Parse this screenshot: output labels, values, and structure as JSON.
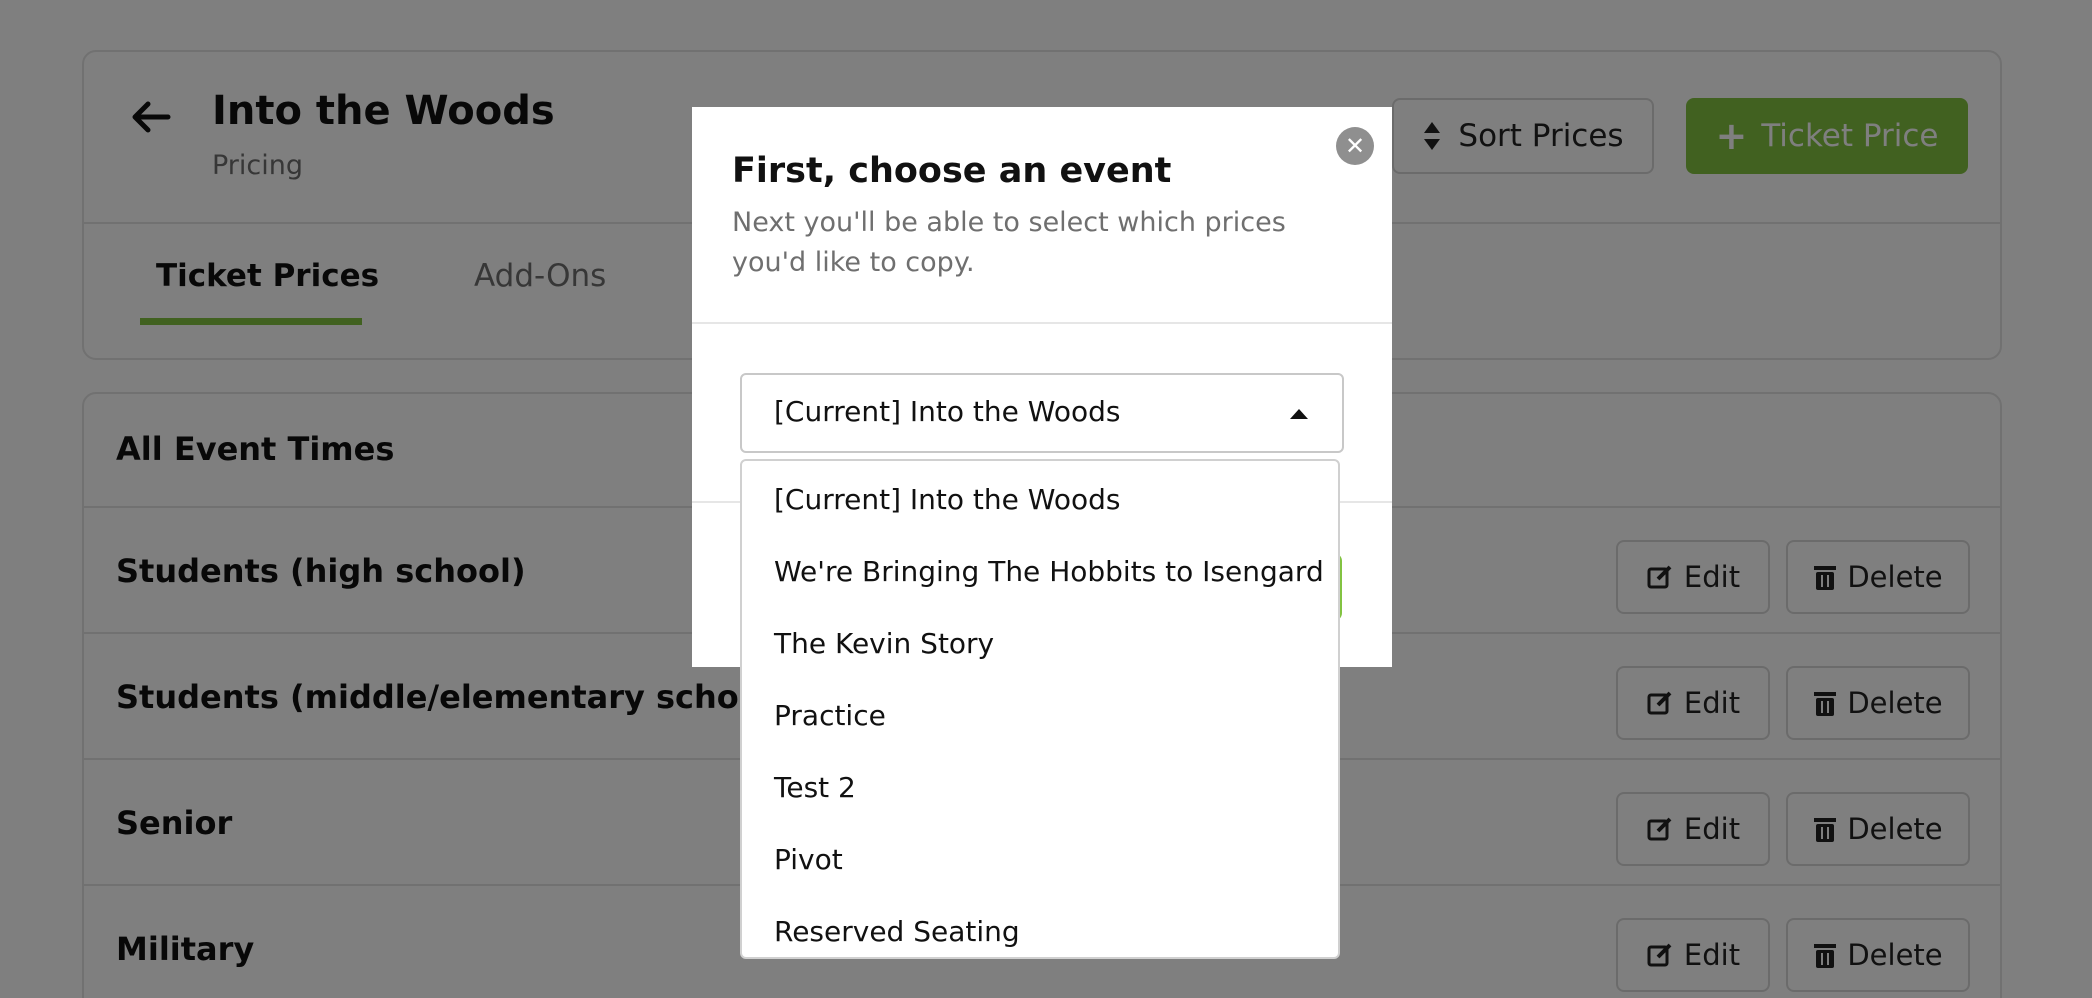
{
  "header": {
    "title": "Into the Woods",
    "subtitle": "Pricing",
    "sort_label": "Sort Prices",
    "add_ticket_label": "Ticket Price",
    "tabs": [
      {
        "label": "Ticket Prices",
        "active": true
      },
      {
        "label": "Add-Ons",
        "active": false
      }
    ]
  },
  "list": {
    "section_title": "All Event Times",
    "rows": [
      {
        "label": "Students (high school)"
      },
      {
        "label": "Students (middle/elementary school)"
      },
      {
        "label": "Senior"
      },
      {
        "label": "Military"
      }
    ],
    "edit_label": "Edit",
    "delete_label": "Delete"
  },
  "modal": {
    "title": "First, choose an event",
    "description": "Next you'll be able to select which prices you'd like to copy.",
    "close_glyph": "✕",
    "select": {
      "value": "[Current] Into the Woods",
      "options": [
        "[Current] Into the Woods",
        "We're Bringing The Hobbits to Isengard",
        "The Kevin Story",
        "Practice",
        "Test 2",
        "Pivot",
        "Reserved Seating"
      ]
    }
  },
  "colors": {
    "accent": "#82c341",
    "overlay": "rgba(0,0,0,0.5)",
    "muted_text": "#6f6f6f"
  }
}
